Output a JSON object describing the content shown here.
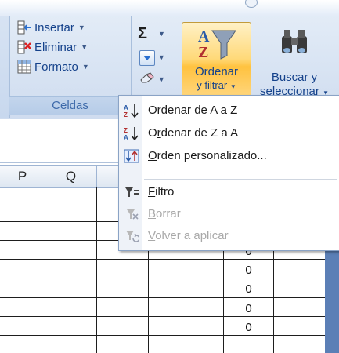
{
  "cells_group": {
    "insert_label": "Insertar",
    "delete_label": "Eliminar",
    "format_label": "Formato",
    "group_label": "Celdas"
  },
  "editing_group": {
    "sum_symbol": "Σ",
    "sort_label_line1": "Ordenar",
    "sort_label_line2": "y filtrar",
    "find_label_line1": "Buscar y",
    "find_label_line2": "seleccionar"
  },
  "sort_menu": {
    "items": [
      {
        "pre": "",
        "u": "O",
        "post": "rdenar de A a Z",
        "icon": "sort-a-to-z-icon",
        "enabled": true
      },
      {
        "pre": "O",
        "u": "r",
        "post": "denar de Z a A",
        "icon": "sort-z-to-a-icon",
        "enabled": true
      },
      {
        "pre": "",
        "u": "O",
        "post": "rden personalizado...",
        "icon": "custom-sort-icon",
        "enabled": true
      },
      {
        "pre": "",
        "u": "F",
        "post": "iltro",
        "icon": "filter-icon",
        "enabled": true
      },
      {
        "pre": "",
        "u": "B",
        "post": "orrar",
        "icon": "clear-filter-icon",
        "enabled": false
      },
      {
        "pre": "",
        "u": "V",
        "post": "olver a aplicar",
        "icon": "reapply-filter-icon",
        "enabled": false
      }
    ]
  },
  "sheet": {
    "column_headers": [
      "P",
      "Q"
    ],
    "cell_values": [
      "0",
      "0",
      "0",
      "0",
      "0"
    ]
  },
  "colors": {
    "ribbon_text": "#15428b",
    "highlight_button": "#ffc23f",
    "disabled_text": "#a9a9a9"
  }
}
